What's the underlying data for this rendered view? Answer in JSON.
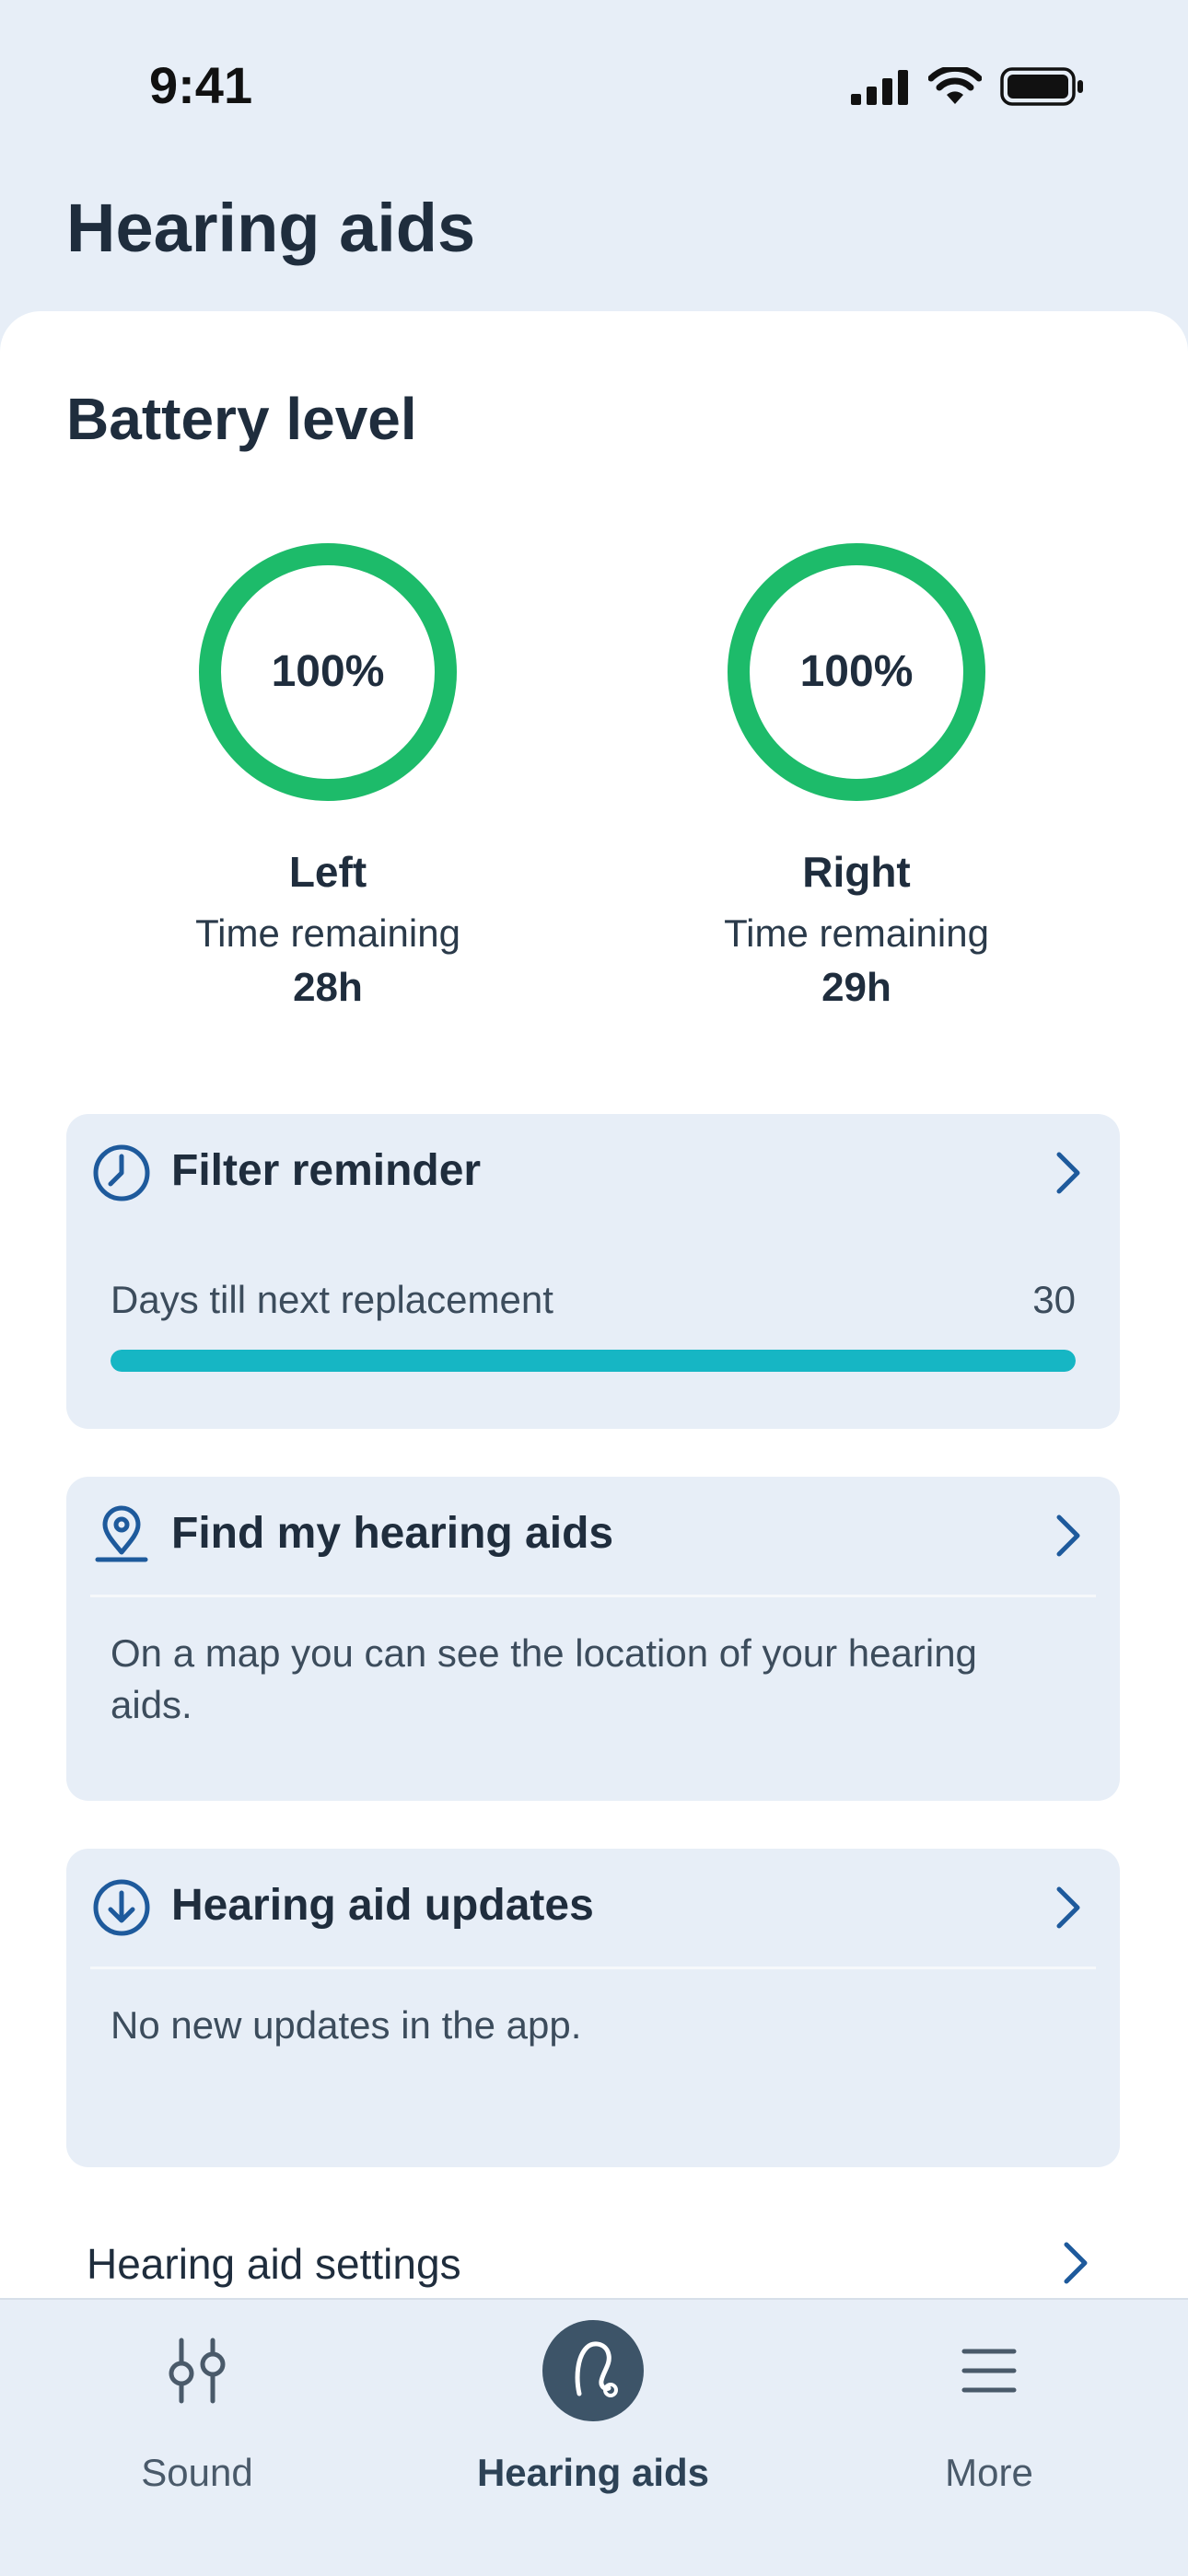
{
  "status_bar": {
    "time": "9:41"
  },
  "header": {
    "title": "Hearing aids"
  },
  "battery": {
    "title": "Battery level",
    "color": "#1dbb6a",
    "devices": [
      {
        "side": "Left",
        "percent": "100%",
        "level": 1.0,
        "time_label": "Time remaining",
        "time_value": "28h"
      },
      {
        "side": "Right",
        "percent": "100%",
        "level": 1.0,
        "time_label": "Time remaining",
        "time_value": "29h"
      }
    ]
  },
  "filter_reminder": {
    "title": "Filter reminder",
    "icon": "clock-icon",
    "progress_label": "Days till next replacement",
    "progress_value": "30",
    "progress_fraction": 1.0,
    "progress_color": "#16b6c4"
  },
  "find_card": {
    "title": "Find my hearing aids",
    "icon": "location-pin-icon",
    "text": "On a map you can see the location of your hearing aids."
  },
  "updates_card": {
    "title": "Hearing aid updates",
    "icon": "download-circle-icon",
    "text": "No new updates in the app."
  },
  "settings_row": {
    "label": "Hearing aid settings"
  },
  "tab_bar": {
    "active": "Hearing aids",
    "tabs": [
      {
        "label": "Sound",
        "icon": "sliders-icon"
      },
      {
        "label": "Hearing aids",
        "icon": "hearing-aid-icon"
      },
      {
        "label": "More",
        "icon": "menu-icon"
      }
    ]
  },
  "colors": {
    "accent": "#1e5a9c",
    "background": "#e7eef7",
    "active_tab": "#3d5468"
  }
}
